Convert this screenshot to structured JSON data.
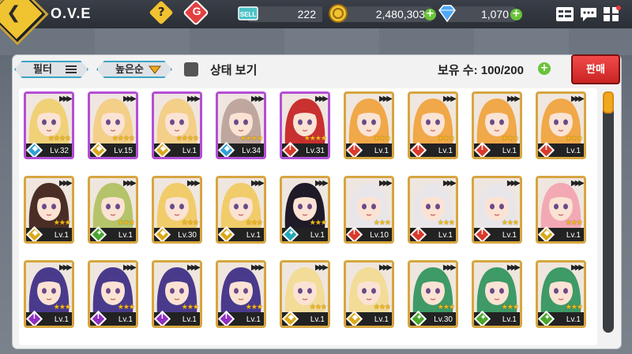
{
  "header": {
    "title": "O.V.E",
    "help_label": "?",
    "g_label": "G",
    "sell_ticket_label": "SELL",
    "resources": [
      {
        "name": "sell-ticket",
        "value": "222"
      },
      {
        "name": "gold",
        "value": "2,480,303"
      },
      {
        "name": "diamond",
        "value": "1,070"
      }
    ],
    "plus_label": "+"
  },
  "toolbar": {
    "filter_label": "필터",
    "sort_label": "높은순",
    "status_view_label": "상태 보기",
    "owned_label": "보유 수: 100/200",
    "sell_label": "판매"
  },
  "colors": {
    "accent_yellow": "#f0c330",
    "element_blue": "#2f9fd6",
    "element_yellow": "#d9a81b",
    "element_red": "#d83a2c",
    "element_purple": "#8d2fc2",
    "element_green": "#4aa52e",
    "element_teal": "#23a7b8",
    "frame_gold": "#d6a640",
    "frame_purple": "#b34fd6"
  },
  "cards": [
    {
      "level": "Lv.32",
      "element": "blue",
      "frame": "purple",
      "hair": "#f0d178",
      "stars": "★★★★"
    },
    {
      "level": "Lv.15",
      "element": "yellow",
      "frame": "purple",
      "hair": "#f4cf88",
      "stars": "★★★★"
    },
    {
      "level": "Lv.1",
      "element": "yellow",
      "frame": "purple",
      "hair": "#f4cf88",
      "stars": "★★★★"
    },
    {
      "level": "Lv.34",
      "element": "blue",
      "frame": "purple",
      "hair": "#bfa7a0",
      "stars": "★★★★"
    },
    {
      "level": "Lv.31",
      "element": "red",
      "frame": "purple",
      "hair": "#c93030",
      "stars": "★★★★"
    },
    {
      "level": "Lv.1",
      "element": "red",
      "frame": "gold",
      "hair": "#f0a848",
      "stars": "★★★"
    },
    {
      "level": "Lv.1",
      "element": "red",
      "frame": "gold",
      "hair": "#f0a848",
      "stars": "★★★"
    },
    {
      "level": "Lv.1",
      "element": "red",
      "frame": "gold",
      "hair": "#f0a848",
      "stars": "★★★"
    },
    {
      "level": "Lv.1",
      "element": "red",
      "frame": "gold",
      "hair": "#f0a848",
      "stars": "★★★"
    },
    {
      "level": "Lv.1",
      "element": "yellow",
      "frame": "gold",
      "hair": "#4a2e26",
      "stars": "★★★"
    },
    {
      "level": "Lv.1",
      "element": "green",
      "frame": "gold",
      "hair": "#b5c46a",
      "stars": "★★★"
    },
    {
      "level": "Lv.30",
      "element": "yellow",
      "frame": "gold",
      "hair": "#f1cc6a",
      "stars": "★★★"
    },
    {
      "level": "Lv.1",
      "element": "yellow",
      "frame": "gold",
      "hair": "#f1cc6a",
      "stars": "★★★"
    },
    {
      "level": "Lv.1",
      "element": "teal",
      "frame": "gold",
      "hair": "#1e1a28",
      "stars": "★★★"
    },
    {
      "level": "Lv.10",
      "element": "red",
      "frame": "gold",
      "hair": "#e9e6ea",
      "stars": "★★★"
    },
    {
      "level": "Lv.1",
      "element": "red",
      "frame": "gold",
      "hair": "#e9e6ea",
      "stars": "★★★"
    },
    {
      "level": "Lv.1",
      "element": "red",
      "frame": "gold",
      "hair": "#e9e6ea",
      "stars": "★★★"
    },
    {
      "level": "Lv.1",
      "element": "yellow",
      "frame": "gold",
      "hair": "#f3a9b4",
      "stars": "★★★"
    },
    {
      "level": "Lv.1",
      "element": "purple",
      "frame": "gold",
      "hair": "#4a3a8c",
      "stars": "★★★"
    },
    {
      "level": "Lv.1",
      "element": "purple",
      "frame": "gold",
      "hair": "#4a3a8c",
      "stars": "★★★"
    },
    {
      "level": "Lv.1",
      "element": "purple",
      "frame": "gold",
      "hair": "#4a3a8c",
      "stars": "★★★"
    },
    {
      "level": "Lv.1",
      "element": "purple",
      "frame": "gold",
      "hair": "#4a3a8c",
      "stars": "★★★"
    },
    {
      "level": "Lv.1",
      "element": "yellow",
      "frame": "gold",
      "hair": "#f2dc98",
      "stars": "★★★"
    },
    {
      "level": "Lv.1",
      "element": "yellow",
      "frame": "gold",
      "hair": "#f2dc98",
      "stars": "★★★"
    },
    {
      "level": "Lv.30",
      "element": "green",
      "frame": "gold",
      "hair": "#3e9a66",
      "stars": "★★★"
    },
    {
      "level": "Lv.1",
      "element": "green",
      "frame": "gold",
      "hair": "#3e9a66",
      "stars": "★★★"
    },
    {
      "level": "Lv.1",
      "element": "green",
      "frame": "gold",
      "hair": "#3e9a66",
      "stars": "★★★"
    }
  ]
}
